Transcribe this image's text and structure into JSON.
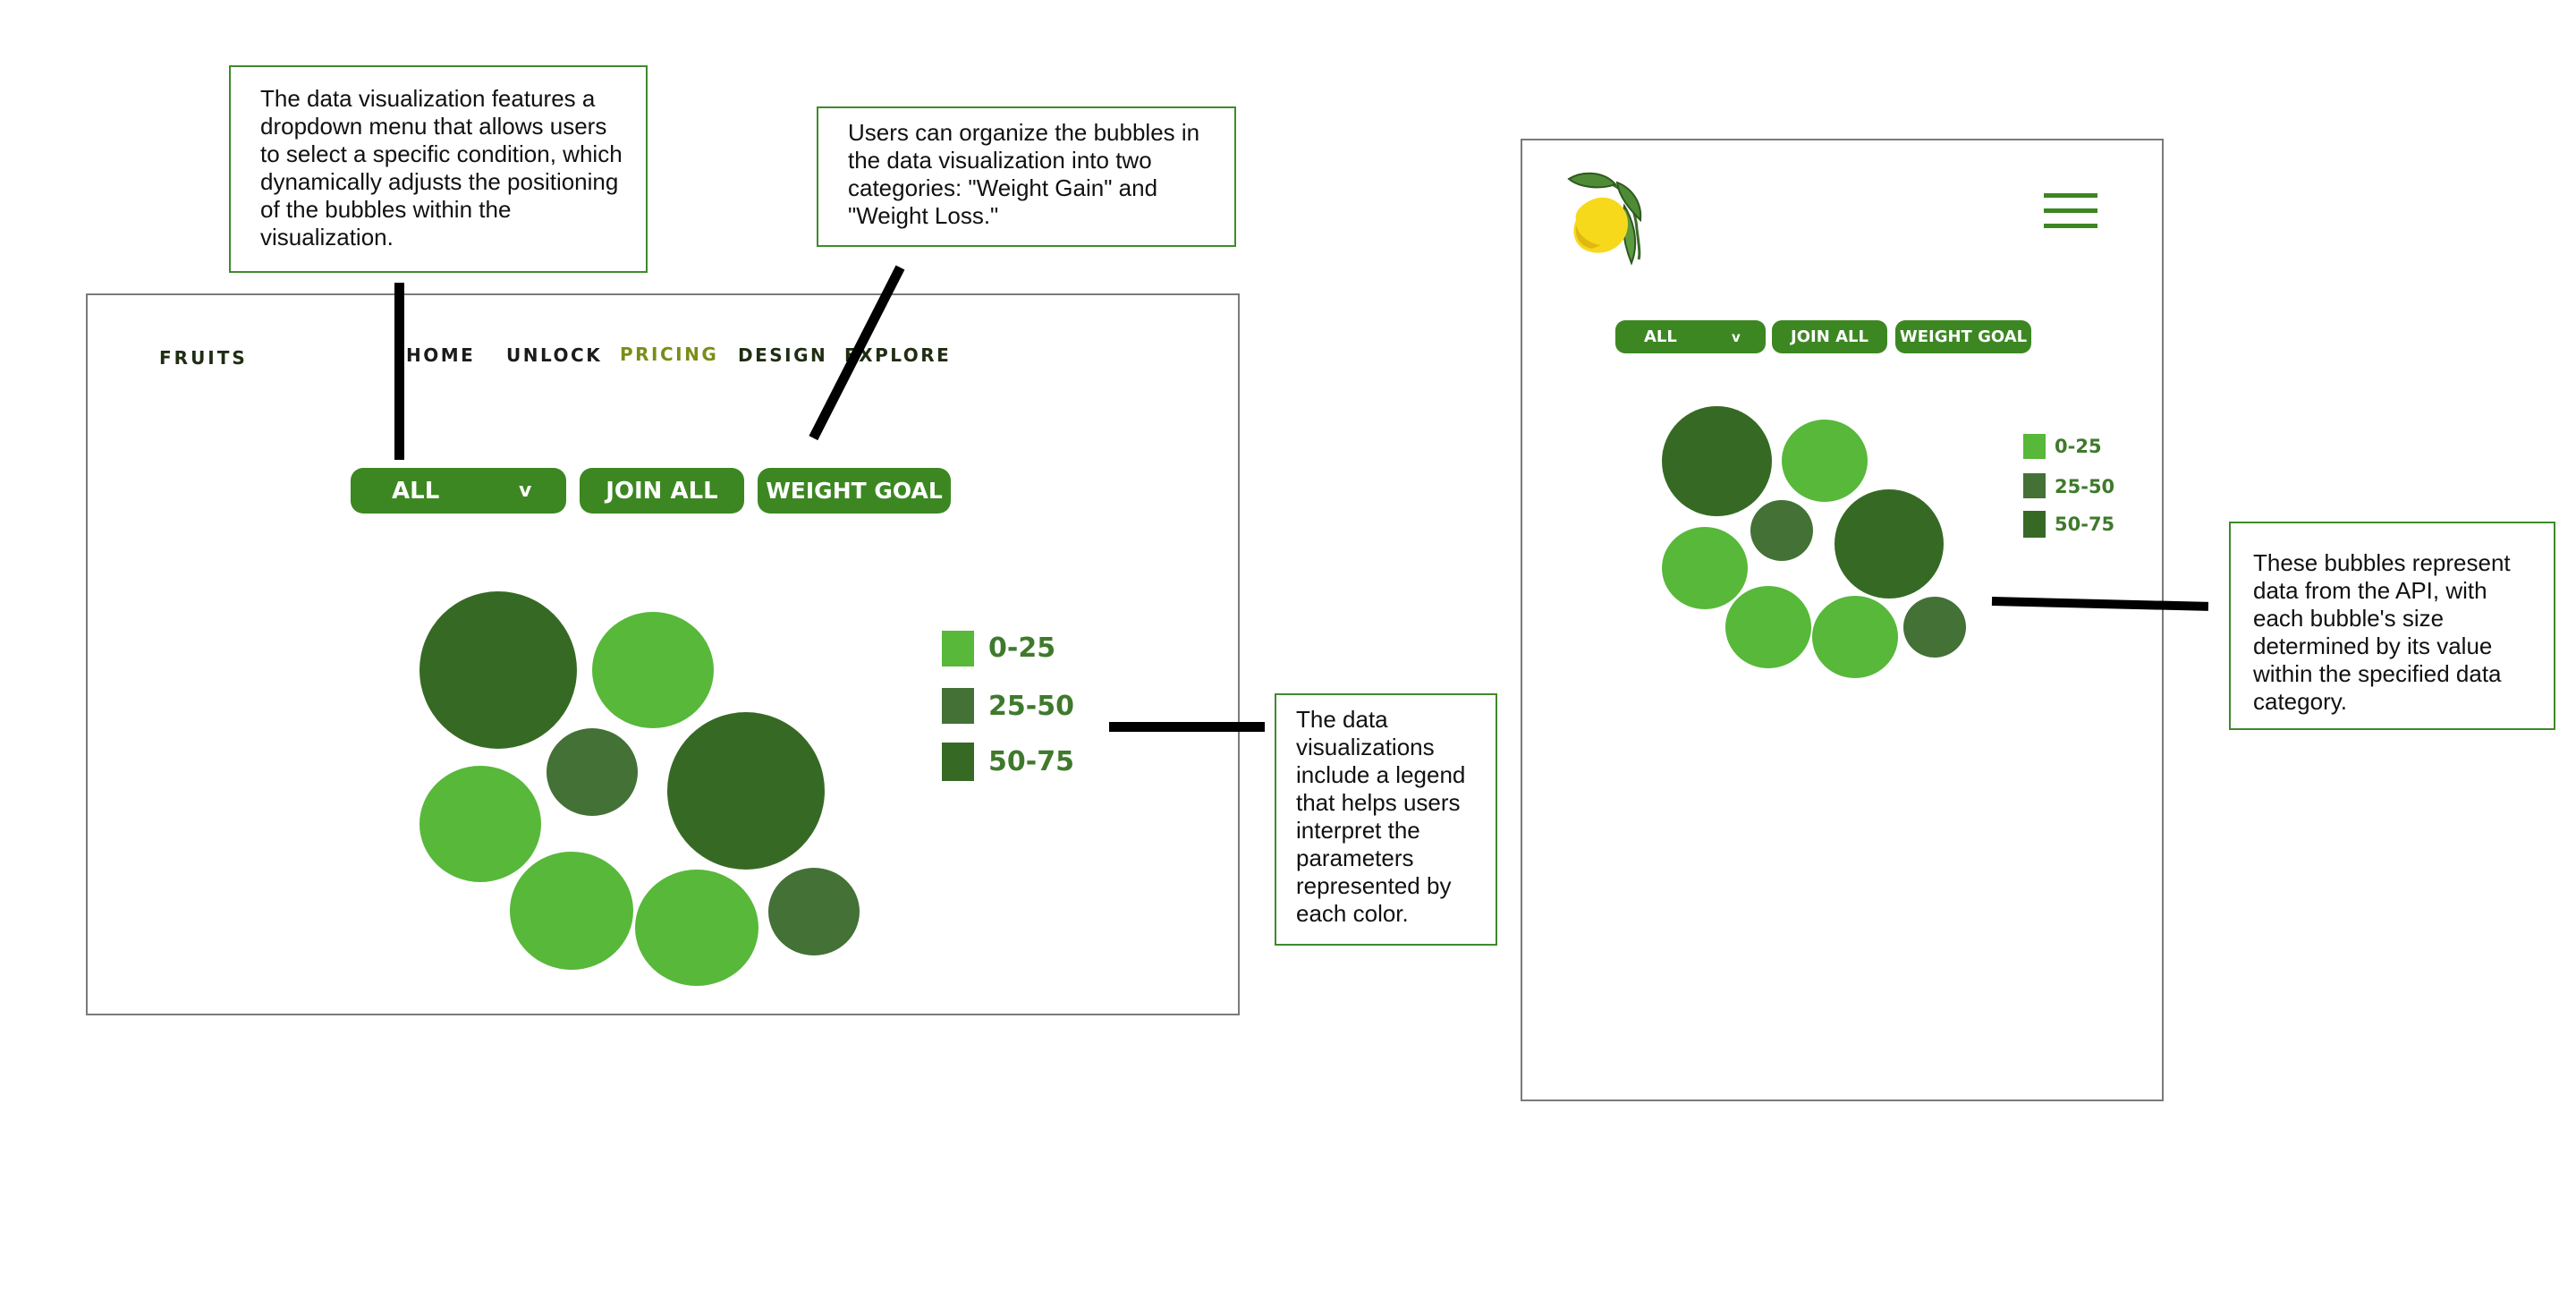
{
  "callouts": {
    "dropdown": "The data visualization features a dropdown menu that allows users to select a specific condition, which dynamically adjusts the positioning of the bubbles within the visualization.",
    "categories": "Users can organize the bubbles in the data visualization into two categories: \"Weight Gain\" and \"Weight Loss.\"",
    "legend": "The data visualizations include a legend that helps users interpret the parameters represented by each color.",
    "bubbles": "These bubbles represent data from the API, with each bubble's size determined by its value within the specified data category."
  },
  "desktop": {
    "brand": "FRUITS",
    "nav": [
      "HOME",
      "UNLOCK",
      "PRICING",
      "DESIGN",
      "EXPLORE"
    ],
    "active_nav": "PRICING",
    "dropdown_value": "ALL",
    "dropdown_chevron": "v",
    "join_all_label": "JOIN ALL",
    "weight_goal_label": "WEIGHT GOAL"
  },
  "mobile": {
    "logo_icon": "lemon-icon",
    "menu_icon": "hamburger-menu-icon",
    "dropdown_value": "ALL",
    "dropdown_chevron": "v",
    "join_all_label": "JOIN ALL",
    "weight_goal_label": "WEIGHT GOAL"
  },
  "legend": [
    {
      "label": "0-25",
      "color": "#57b83a"
    },
    {
      "label": "25-50",
      "color": "#437136"
    },
    {
      "label": "50-75",
      "color": "#366a24"
    }
  ],
  "colors": {
    "accent": "#3c8722",
    "active_nav": "#7c8c18",
    "dark_green": "#366a24",
    "mid_green": "#437136",
    "light_green": "#57b83a"
  }
}
